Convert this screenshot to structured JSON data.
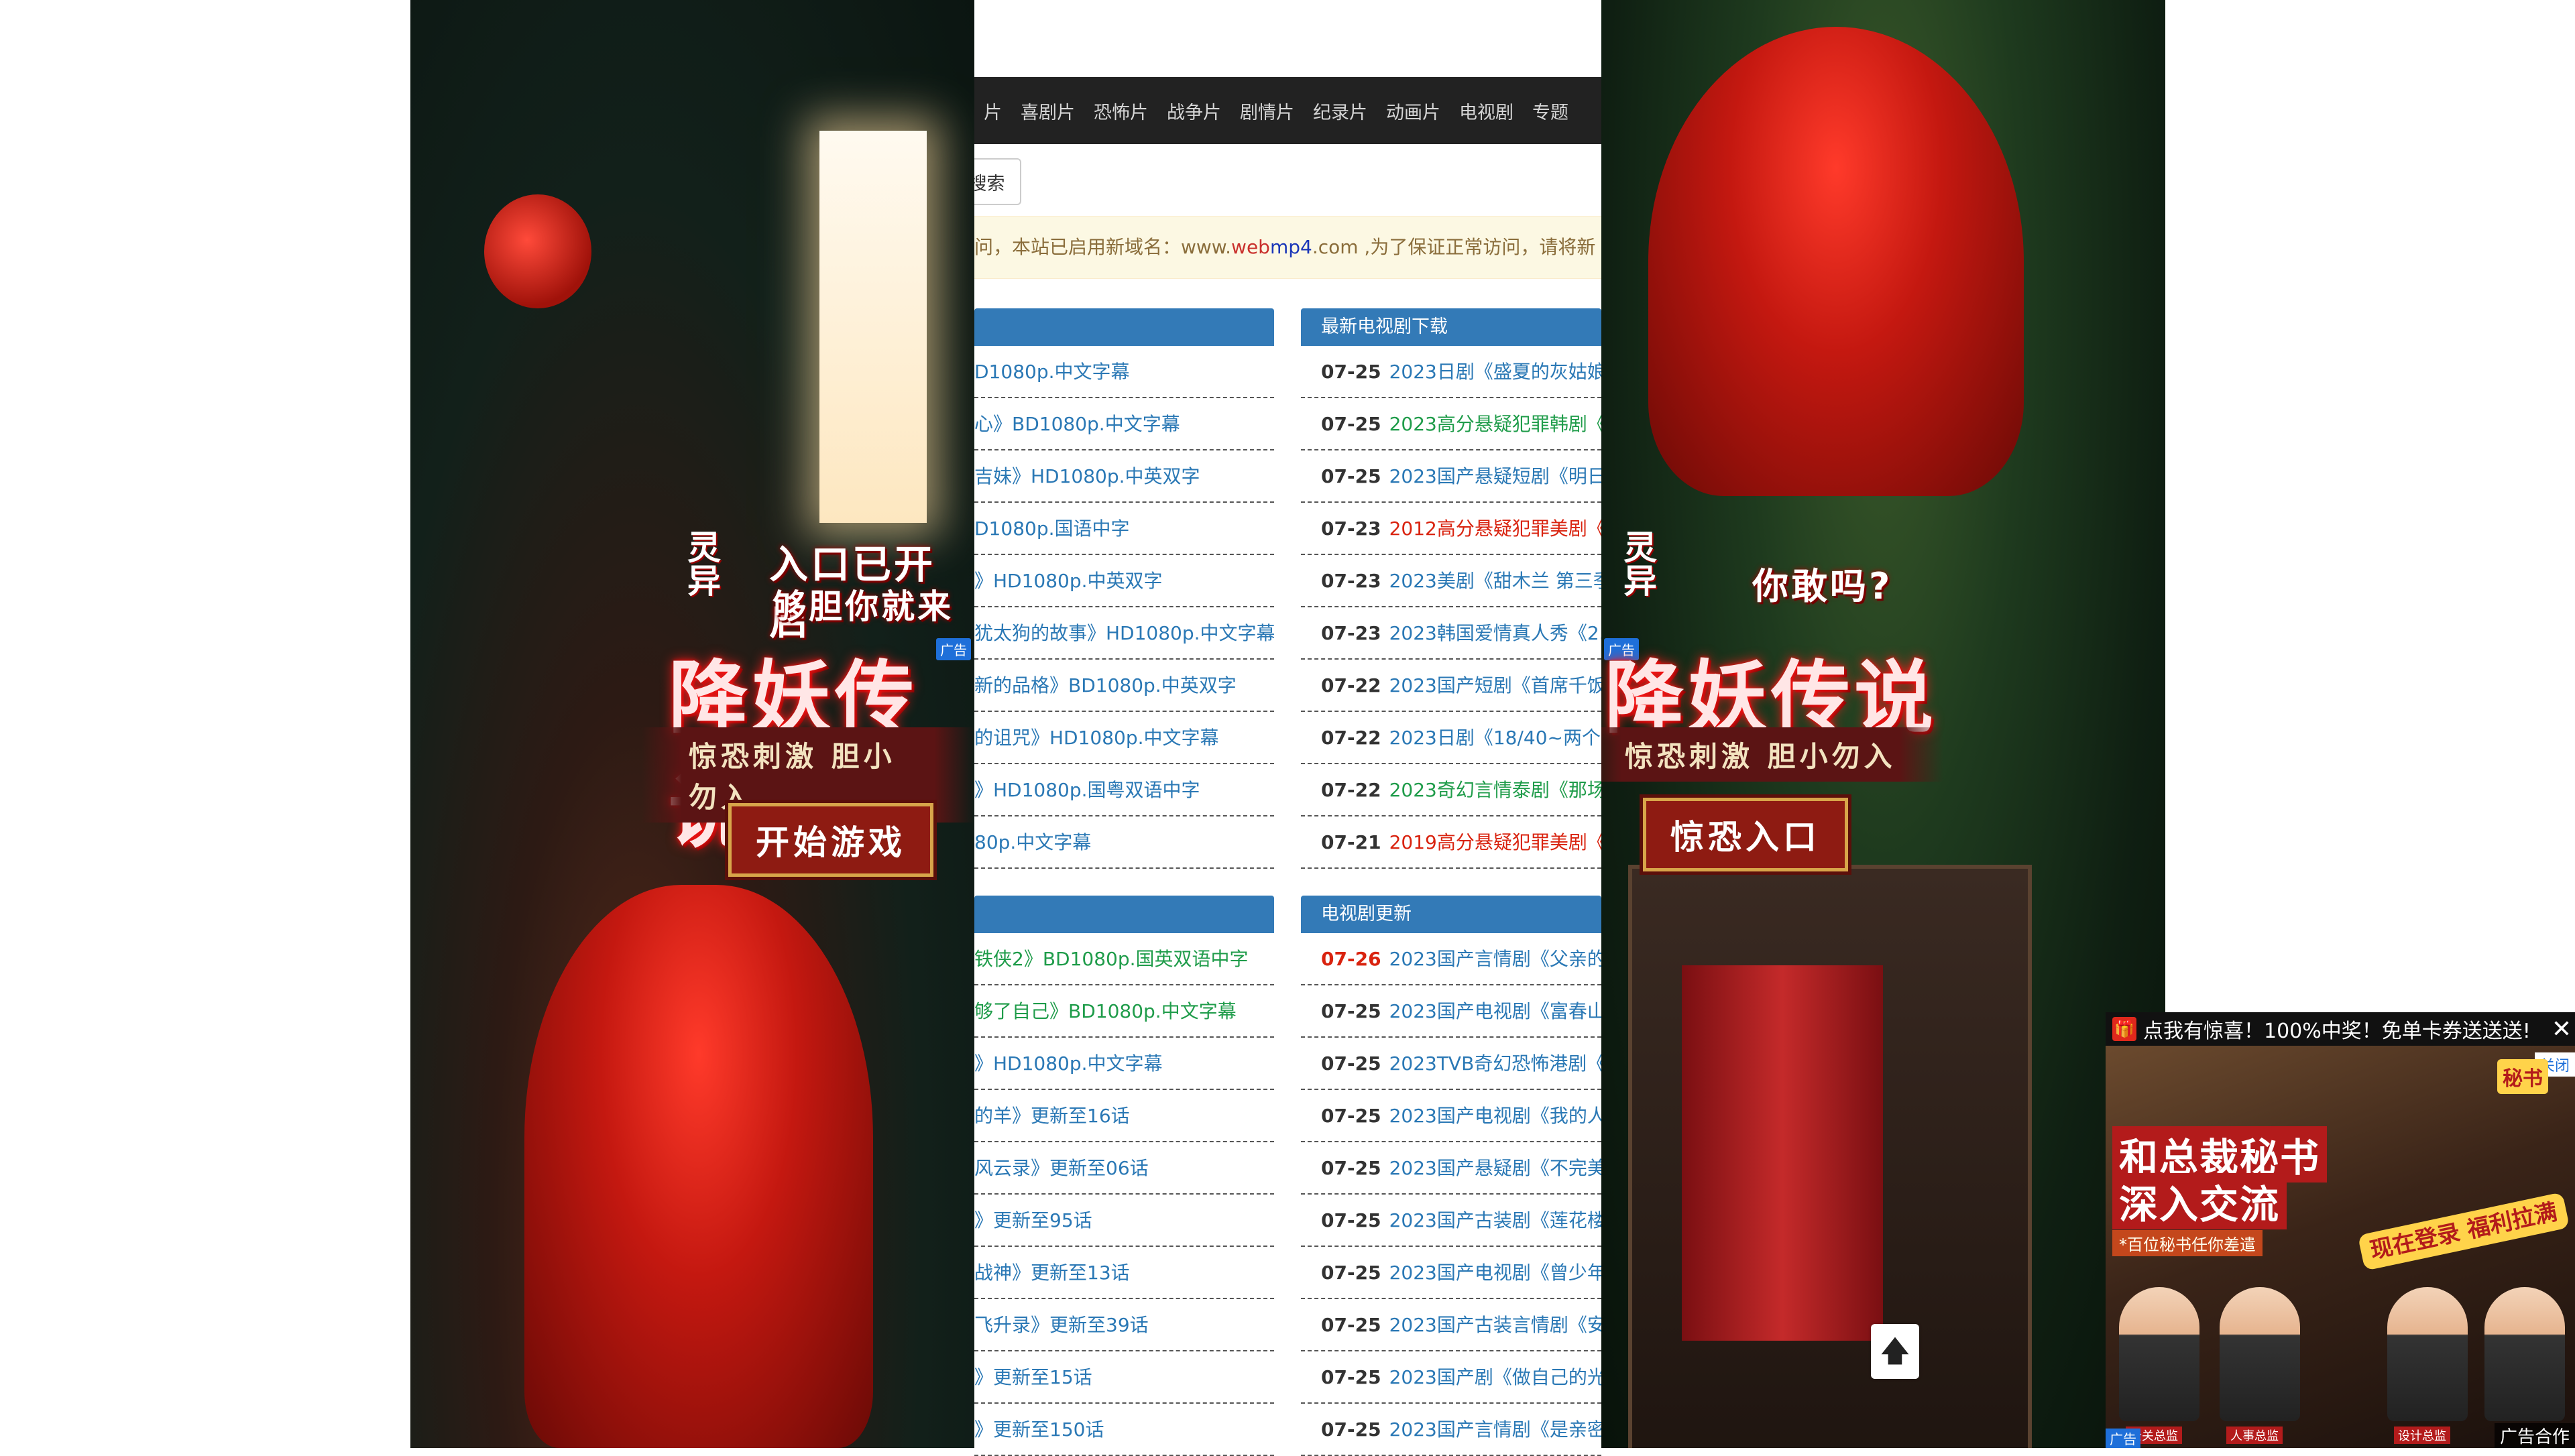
{
  "nav": {
    "items": [
      "片",
      "喜剧片",
      "恐怖片",
      "战争片",
      "剧情片",
      "纪录片",
      "动画片",
      "电视剧",
      "专题"
    ]
  },
  "search": {
    "button_label": "搜索"
  },
  "notice": {
    "prefix": "问，本站已启用新域名：www.",
    "domain_red": "web",
    "domain_blue": "mp4",
    "suffix": ".com ,为了保证正常访问，请将新"
  },
  "panels": {
    "left1": {
      "items": [
        {
          "text": "D1080p.中文字幕",
          "color": "blue"
        },
        {
          "text": "心》BD1080p.中文字幕",
          "color": "blue"
        },
        {
          "text": "吉妹》HD1080p.中英双字",
          "color": "blue"
        },
        {
          "text": "D1080p.国语中字",
          "color": "blue"
        },
        {
          "text": "》HD1080p.中英双字",
          "color": "blue"
        },
        {
          "text": "犹太狗的故事》HD1080p.中文字幕",
          "color": "blue"
        },
        {
          "text": "新的品格》BD1080p.中英双字",
          "color": "blue"
        },
        {
          "text": "的诅咒》HD1080p.中文字幕",
          "color": "blue"
        },
        {
          "text": "》HD1080p.国粤双语中字",
          "color": "blue"
        },
        {
          "text": "80p.中文字幕",
          "color": "blue"
        }
      ]
    },
    "right1": {
      "title": "最新电视剧下载",
      "items": [
        {
          "date": "07-25",
          "text": "2023日剧《盛夏的灰姑娘",
          "color": "blue"
        },
        {
          "date": "07-25",
          "text": "2023高分悬疑犯罪韩剧《",
          "color": "green"
        },
        {
          "date": "07-25",
          "text": "2023国产悬疑短剧《明日",
          "color": "blue"
        },
        {
          "date": "07-23",
          "text": "2012高分悬疑犯罪美剧《",
          "color": "red"
        },
        {
          "date": "07-23",
          "text": "2023美剧《甜木兰 第三季",
          "color": "blue"
        },
        {
          "date": "07-23",
          "text": "2023韩国爱情真人秀《2.",
          "color": "blue"
        },
        {
          "date": "07-22",
          "text": "2023国产短剧《首席千饭",
          "color": "blue"
        },
        {
          "date": "07-22",
          "text": "2023日剧《18/40~两个",
          "color": "blue"
        },
        {
          "date": "07-22",
          "text": "2023奇幻言情泰剧《那场",
          "color": "green"
        },
        {
          "date": "07-21",
          "text": "2019高分悬疑犯罪美剧《",
          "color": "red"
        }
      ]
    },
    "left2": {
      "items": [
        {
          "text": "铁侠2》BD1080p.国英双语中字",
          "color": "green"
        },
        {
          "text": "够了自己》BD1080p.中文字幕",
          "color": "green"
        },
        {
          "text": "》HD1080p.中文字幕",
          "color": "blue"
        },
        {
          "text": "的羊》更新至16话",
          "color": "blue"
        },
        {
          "text": "风云录》更新至06话",
          "color": "blue"
        },
        {
          "text": "》更新至95话",
          "color": "blue"
        },
        {
          "text": "战神》更新至13话",
          "color": "blue"
        },
        {
          "text": "飞升录》更新至39话",
          "color": "blue"
        },
        {
          "text": "》更新至15话",
          "color": "blue"
        },
        {
          "text": "》更新至150话",
          "color": "blue"
        }
      ]
    },
    "right2": {
      "title": "电视剧更新",
      "items": [
        {
          "date": "07-26",
          "date_red": true,
          "text": "2023国产言情剧《父亲的",
          "color": "blue"
        },
        {
          "date": "07-25",
          "text": "2023国产电视剧《富春山",
          "color": "blue"
        },
        {
          "date": "07-25",
          "text": "2023TVB奇幻恐怖港剧《",
          "color": "blue"
        },
        {
          "date": "07-25",
          "text": "2023国产电视剧《我的人",
          "color": "blue"
        },
        {
          "date": "07-25",
          "text": "2023国产悬疑剧《不完美",
          "color": "blue"
        },
        {
          "date": "07-25",
          "text": "2023国产古装剧《莲花楼",
          "color": "blue"
        },
        {
          "date": "07-25",
          "text": "2023国产电视剧《曾少年",
          "color": "blue"
        },
        {
          "date": "07-25",
          "text": "2023国产古装言情剧《安",
          "color": "blue"
        },
        {
          "date": "07-25",
          "text": "2023国产剧《做自己的光",
          "color": "blue"
        },
        {
          "date": "07-25",
          "text": "2023国产言情剧《是亲密",
          "color": "blue"
        }
      ]
    }
  },
  "ad_left": {
    "tag": "广告",
    "mark": "灵异",
    "line1": "入口已开启",
    "line2": "够胆你就来",
    "title": "降妖传说",
    "subtitle": "惊恐刺激 胆小勿入",
    "button": "开始游戏"
  },
  "ad_right": {
    "tag": "广告",
    "mark": "灵异",
    "line1": "你敢吗?",
    "title": "降妖传说",
    "subtitle": "惊恐刺激 胆小勿入",
    "button": "惊恐入口"
  },
  "popup": {
    "title": "点我有惊喜！100%中奖！免单卡券送送送!",
    "close_glyph": "✕",
    "close_tag": "关闭",
    "headline1": "和总裁秘书",
    "headline2": "深入交流",
    "tagline": "*百位秘书任你差遣",
    "sticker": "现在登录 福利拉满",
    "badge": "秘书",
    "roles": [
      "公关总监",
      "人事总监",
      "设计总监"
    ],
    "ad_corner": "广告",
    "coop": "广告合作"
  },
  "totop": {
    "glyph": "🡅"
  },
  "colors": {
    "nav_bg": "#222222",
    "panel_head": "#337ab7",
    "link_blue": "#2a78b5",
    "link_green": "#1f9c4a",
    "link_red": "#d9230f",
    "notice_bg": "#fcf8e3"
  }
}
